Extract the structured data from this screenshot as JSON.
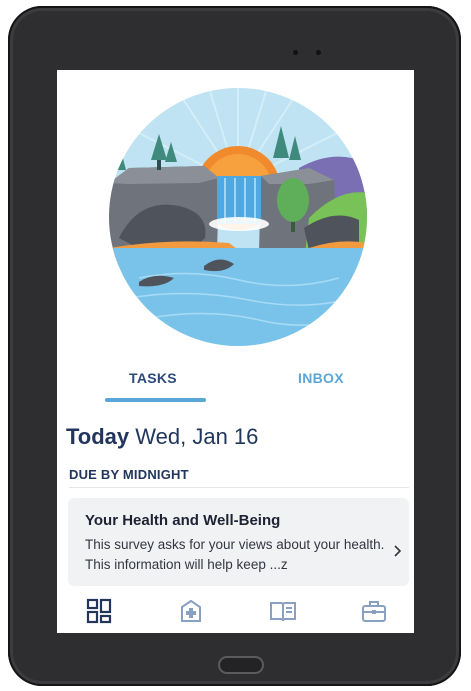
{
  "tabs": [
    {
      "label": "TASKS",
      "active": true
    },
    {
      "label": "INBOX",
      "active": false
    }
  ],
  "date": {
    "today": "Today",
    "date": "Wed, Jan 16"
  },
  "section": {
    "header": "DUE BY MIDNIGHT"
  },
  "task_card": {
    "title": "Your Health and Well-Being",
    "description": "This survey asks for your views about your health. This information will help keep ...z"
  },
  "bottom_nav": {
    "items": [
      {
        "icon": "dashboard-icon",
        "active": true
      },
      {
        "icon": "medical-plus-icon",
        "active": false
      },
      {
        "icon": "book-icon",
        "active": false
      },
      {
        "icon": "briefcase-icon",
        "active": false
      }
    ]
  },
  "colors": {
    "navy": "#22355c",
    "accent_blue": "#5aa6d6",
    "nav_inactive": "#8aa0c0",
    "card_bg": "#f1f2f4",
    "device_frame": "#2e2e30"
  }
}
